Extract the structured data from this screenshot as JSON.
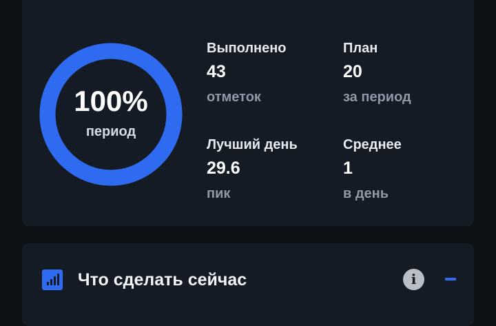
{
  "progress": {
    "percent_text": "100%",
    "percent_value": 100,
    "label": "период",
    "ring_color": "#2f6bf0",
    "track_color": "#232b38"
  },
  "stats": [
    {
      "label": "Выполнено",
      "value": "43",
      "sub": "отметок"
    },
    {
      "label": "План",
      "value": "20",
      "sub": "за период"
    },
    {
      "label": "Лучший день",
      "value": "29.6",
      "sub": "пик"
    },
    {
      "label": "Среднее",
      "value": "1",
      "sub": "в день"
    }
  ],
  "action_card": {
    "title": "Что сделать сейчас",
    "icon": "bar-chart-icon",
    "info_icon": "info-icon",
    "toggle_icon": "minus-icon"
  }
}
